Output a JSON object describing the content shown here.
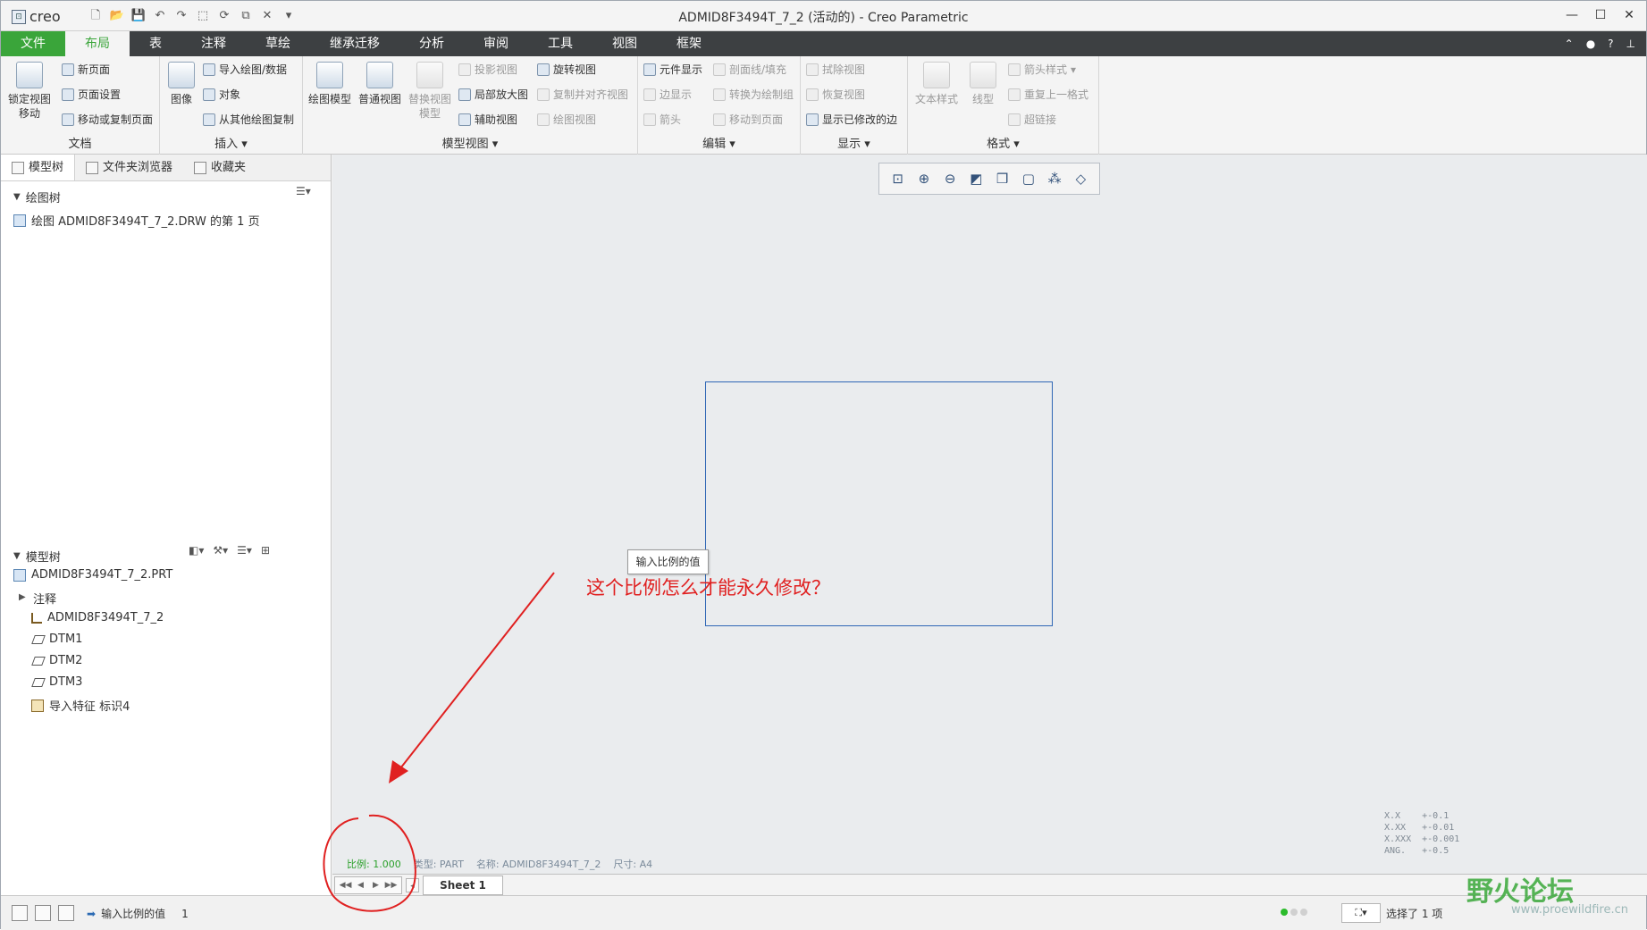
{
  "app": {
    "logo": "creo",
    "title": "ADMID8F3494T_7_2 (活动的) - Creo Parametric"
  },
  "window_controls": {
    "minimize": "—",
    "maximize": "☐",
    "close": "✕"
  },
  "ribbon_tabs": [
    "文件",
    "布局",
    "表",
    "注释",
    "草绘",
    "继承迁移",
    "分析",
    "审阅",
    "工具",
    "视图",
    "框架"
  ],
  "ribbon": {
    "document": {
      "label": "文档",
      "lock_view_line1": "锁定视图",
      "lock_view_line2": "移动",
      "new_page": "新页面",
      "page_setup": "页面设置",
      "move_copy_page": "移动或复制页面"
    },
    "insert": {
      "label": "插入",
      "image": "图像",
      "import_drawing": "导入绘图/数据",
      "object": "对象",
      "copy_from_other": "从其他绘图复制"
    },
    "model_views": {
      "label": "模型视图",
      "drawing_model": "绘图模型",
      "general_view": "普通视图",
      "replace_view_line1": "替换视图",
      "replace_view_line2": "模型",
      "projection": "投影视图",
      "detailed": "局部放大图",
      "auxiliary": "辅助视图",
      "revolved": "旋转视图",
      "copy_align": "复制并对齐视图",
      "drawing_view": "绘图视图"
    },
    "edit": {
      "label": "编辑",
      "component_display": "元件显示",
      "edge_display": "边显示",
      "arrow": "箭头",
      "xhatch": "剖面线/填充",
      "convert_group": "转换为绘制组",
      "move_to_page": "移动到页面"
    },
    "display": {
      "label": "显示",
      "erase_view": "拭除视图",
      "restore_view": "恢复视图",
      "show_modified_edges": "显示已修改的边"
    },
    "format": {
      "label": "格式",
      "text_style": "文本样式",
      "line_style": "线型",
      "arrow_style": "箭头样式",
      "repeat_format": "重复上一格式",
      "hyperlink": "超链接"
    }
  },
  "panel": {
    "tabs": [
      "模型树",
      "文件夹浏览器",
      "收藏夹"
    ],
    "drawing_tree": {
      "header": "绘图树",
      "item": "绘图 ADMID8F3494T_7_2.DRW 的第 1 页"
    },
    "model_tree": {
      "header": "模型树",
      "items": [
        "ADMID8F3494T_7_2.PRT",
        "注释",
        "ADMID8F3494T_7_2",
        "DTM1",
        "DTM2",
        "DTM3",
        "导入特征 标识4"
      ]
    }
  },
  "canvas": {
    "tooltip": "输入比例的值",
    "annotation": "这个比例怎么才能永久修改？",
    "info": {
      "scale": "比例: 1.000",
      "type": "类型: PART",
      "name": "名称: ADMID8F3494T_7_2",
      "size": "尺寸: A4"
    },
    "tolerances": "X.X    +-0.1\nX.XX   +-0.01\nX.XXX  +-0.001\nANG.   +-0.5",
    "annotation_color": "#e02020",
    "sheet_outline_color": "#2f66b5"
  },
  "sheet_tabs": {
    "current": "Sheet 1"
  },
  "statusbar": {
    "message": "输入比例的值",
    "message_count": "1",
    "selection": "选择了 1 项"
  },
  "watermark": {
    "text": "野火论坛",
    "url": "www.proewildfire.cn"
  }
}
